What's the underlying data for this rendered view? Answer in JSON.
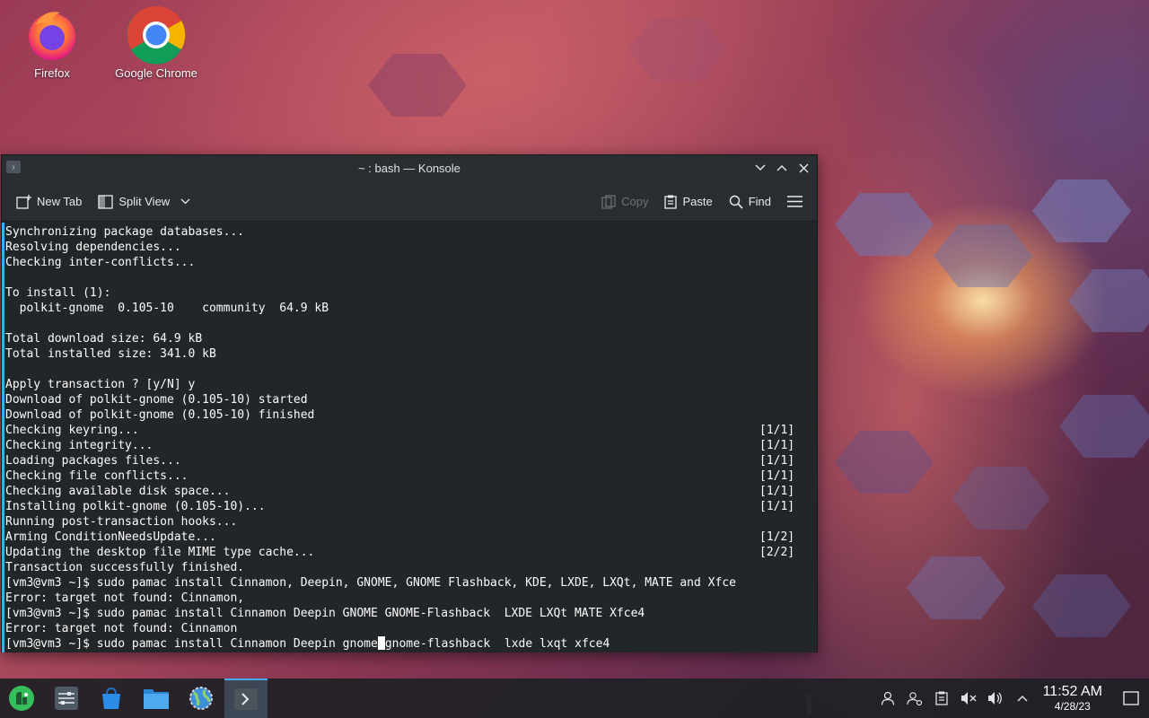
{
  "desktop": {
    "icons": [
      {
        "label": "Firefox"
      },
      {
        "label": "Google Chrome"
      }
    ]
  },
  "window": {
    "title": "~ : bash — Konsole",
    "toolbar": {
      "new_tab": "New Tab",
      "split_view": "Split View",
      "copy": "Copy",
      "paste": "Paste",
      "find": "Find"
    }
  },
  "terminal": {
    "lines": [
      {
        "text": "Synchronizing package databases...",
        "status": ""
      },
      {
        "text": "Resolving dependencies...",
        "status": ""
      },
      {
        "text": "Checking inter-conflicts...",
        "status": ""
      },
      {
        "text": "",
        "status": ""
      },
      {
        "text": "To install (1):",
        "status": ""
      },
      {
        "text": "  polkit-gnome  0.105-10    community  64.9 kB",
        "status": ""
      },
      {
        "text": "",
        "status": ""
      },
      {
        "text": "Total download size: 64.9 kB",
        "status": ""
      },
      {
        "text": "Total installed size: 341.0 kB",
        "status": ""
      },
      {
        "text": "",
        "status": ""
      },
      {
        "text": "Apply transaction ? [y/N] y",
        "status": ""
      },
      {
        "text": "Download of polkit-gnome (0.105-10) started",
        "status": ""
      },
      {
        "text": "Download of polkit-gnome (0.105-10) finished",
        "status": ""
      },
      {
        "text": "Checking keyring...",
        "status": "[1/1]"
      },
      {
        "text": "Checking integrity...",
        "status": "[1/1]"
      },
      {
        "text": "Loading packages files...",
        "status": "[1/1]"
      },
      {
        "text": "Checking file conflicts...",
        "status": "[1/1]"
      },
      {
        "text": "Checking available disk space...",
        "status": "[1/1]"
      },
      {
        "text": "Installing polkit-gnome (0.105-10)...",
        "status": "[1/1]"
      },
      {
        "text": "Running post-transaction hooks...",
        "status": ""
      },
      {
        "text": "Arming ConditionNeedsUpdate...",
        "status": "[1/2]"
      },
      {
        "text": "Updating the desktop file MIME type cache...",
        "status": "[2/2]"
      },
      {
        "text": "Transaction successfully finished.",
        "status": ""
      },
      {
        "text": "[vm3@vm3 ~]$ sudo pamac install Cinnamon, Deepin, GNOME, GNOME Flashback, KDE, LXDE, LXQt, MATE and Xfce",
        "status": ""
      },
      {
        "text": "Error: target not found: Cinnamon,",
        "status": ""
      },
      {
        "text": "[vm3@vm3 ~]$ sudo pamac install Cinnamon Deepin GNOME GNOME-Flashback  LXDE LXQt MATE Xfce4",
        "status": ""
      },
      {
        "text": "Error: target not found: Cinnamon",
        "status": ""
      }
    ],
    "prompt_line": {
      "before_cursor": "[vm3@vm3 ~]$ sudo pamac install Cinnamon Deepin gnome",
      "after_cursor": "gnome-flashback  lxde lxqt xfce4"
    }
  },
  "taskbar": {
    "items": [
      {
        "icon": "manjaro-logo-icon"
      },
      {
        "icon": "system-settings-icon"
      },
      {
        "icon": "software-store-icon"
      },
      {
        "icon": "file-manager-icon"
      },
      {
        "icon": "network-globe-icon"
      },
      {
        "icon": "konsole-icon",
        "active": true
      }
    ],
    "clock": {
      "time": "11:52 AM",
      "date": "4/28/23"
    }
  },
  "colors": {
    "accent": "#3daee9",
    "terminal_bg": "#232629",
    "titlebar_bg": "#2a2e32"
  }
}
